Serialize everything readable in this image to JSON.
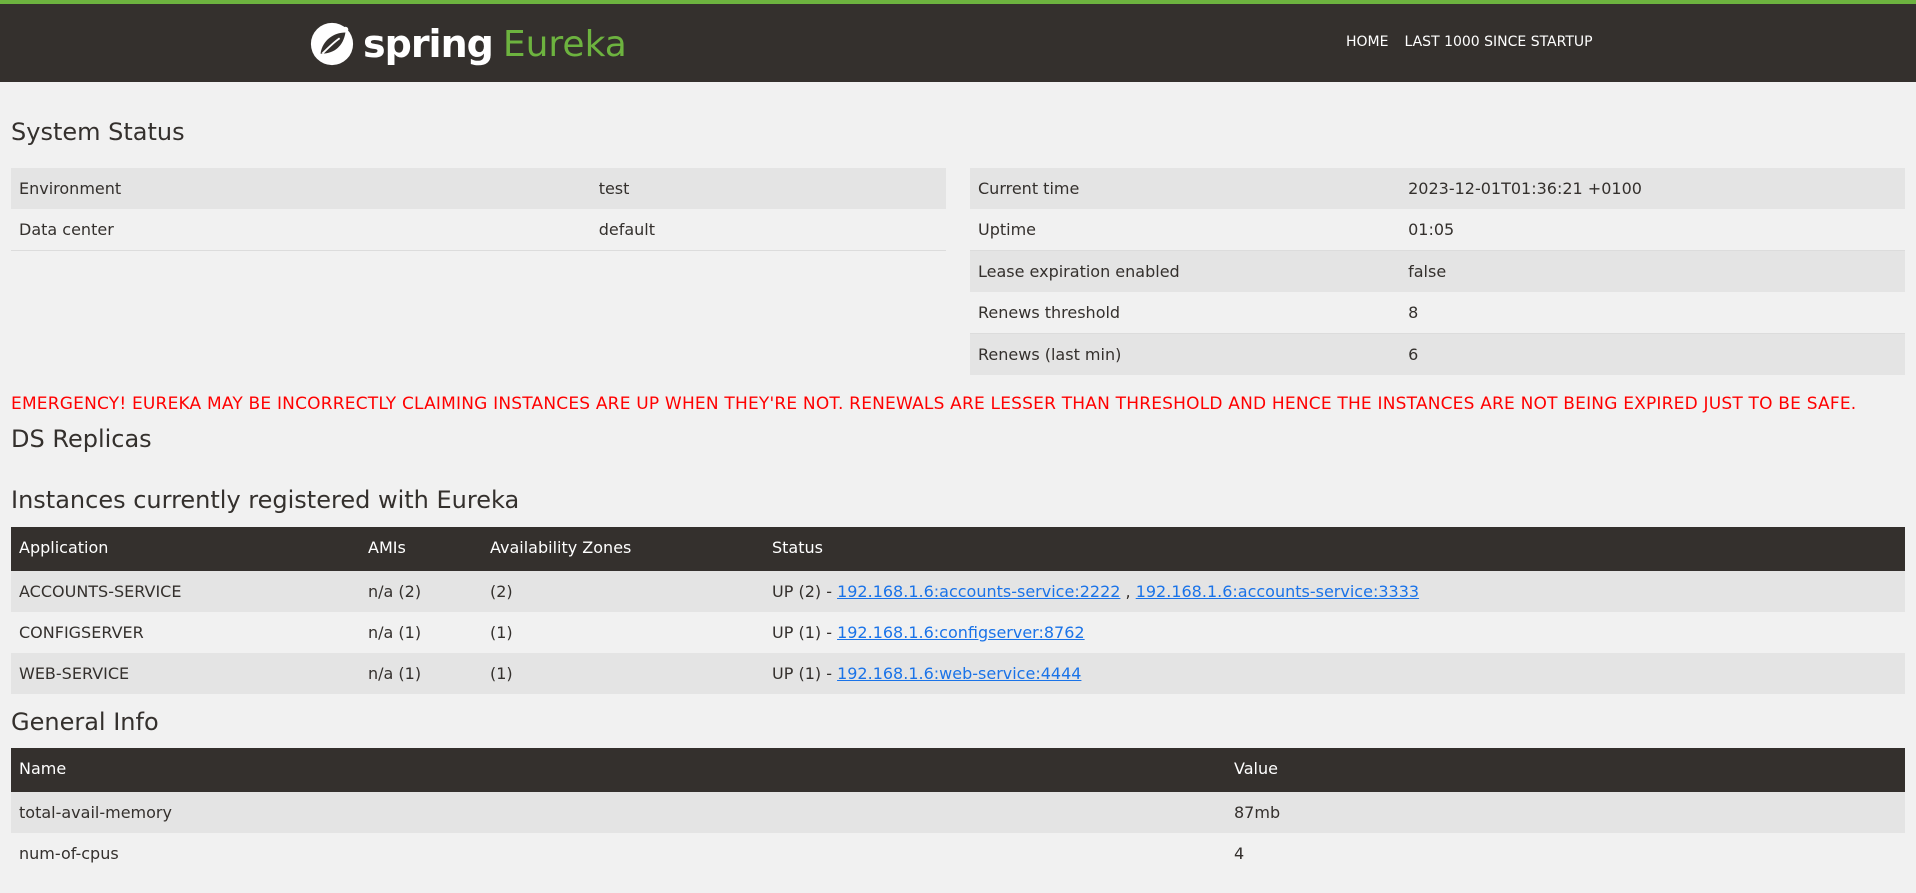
{
  "header": {
    "brand_spring": "spring",
    "brand_eureka": "Eureka",
    "nav": [
      {
        "label": "HOME"
      },
      {
        "label": "LAST 1000 SINCE STARTUP"
      }
    ]
  },
  "system_status": {
    "title": "System Status",
    "left": [
      {
        "key": "Environment",
        "value": "test"
      },
      {
        "key": "Data center",
        "value": "default"
      }
    ],
    "right": [
      {
        "key": "Current time",
        "value": "2023-12-01T01:36:21 +0100"
      },
      {
        "key": "Uptime",
        "value": "01:05"
      },
      {
        "key": "Lease expiration enabled",
        "value": "false"
      },
      {
        "key": "Renews threshold",
        "value": "8"
      },
      {
        "key": "Renews (last min)",
        "value": "6"
      }
    ]
  },
  "emergency": "EMERGENCY! EUREKA MAY BE INCORRECTLY CLAIMING INSTANCES ARE UP WHEN THEY'RE NOT. RENEWALS ARE LESSER THAN THRESHOLD AND HENCE THE INSTANCES ARE NOT BEING EXPIRED JUST TO BE SAFE.",
  "ds_replicas": {
    "title": "DS Replicas"
  },
  "instances": {
    "title": "Instances currently registered with Eureka",
    "headers": [
      "Application",
      "AMIs",
      "Availability Zones",
      "Status"
    ],
    "rows": [
      {
        "application": "ACCOUNTS-SERVICE",
        "amis": "n/a (2)",
        "zones": "(2)",
        "status_prefix": "UP (2) - ",
        "links": [
          "192.168.1.6:accounts-service:2222",
          "192.168.1.6:accounts-service:3333"
        ],
        "separator": " , "
      },
      {
        "application": "CONFIGSERVER",
        "amis": "n/a (1)",
        "zones": "(1)",
        "status_prefix": "UP (1) - ",
        "links": [
          "192.168.1.6:configserver:8762"
        ]
      },
      {
        "application": "WEB-SERVICE",
        "amis": "n/a (1)",
        "zones": "(1)",
        "status_prefix": "UP (1) - ",
        "links": [
          "192.168.1.6:web-service:4444"
        ]
      }
    ]
  },
  "general_info": {
    "title": "General Info",
    "headers": [
      "Name",
      "Value"
    ],
    "rows": [
      {
        "name": "total-avail-memory",
        "value": "87mb"
      },
      {
        "name": "num-of-cpus",
        "value": "4"
      }
    ]
  },
  "colors": {
    "header_bg": "#34302d",
    "accent_green": "#6db33f",
    "emergency_red": "#ff0000",
    "link_blue": "#1a73e8",
    "page_bg": "#f1f1f1"
  }
}
